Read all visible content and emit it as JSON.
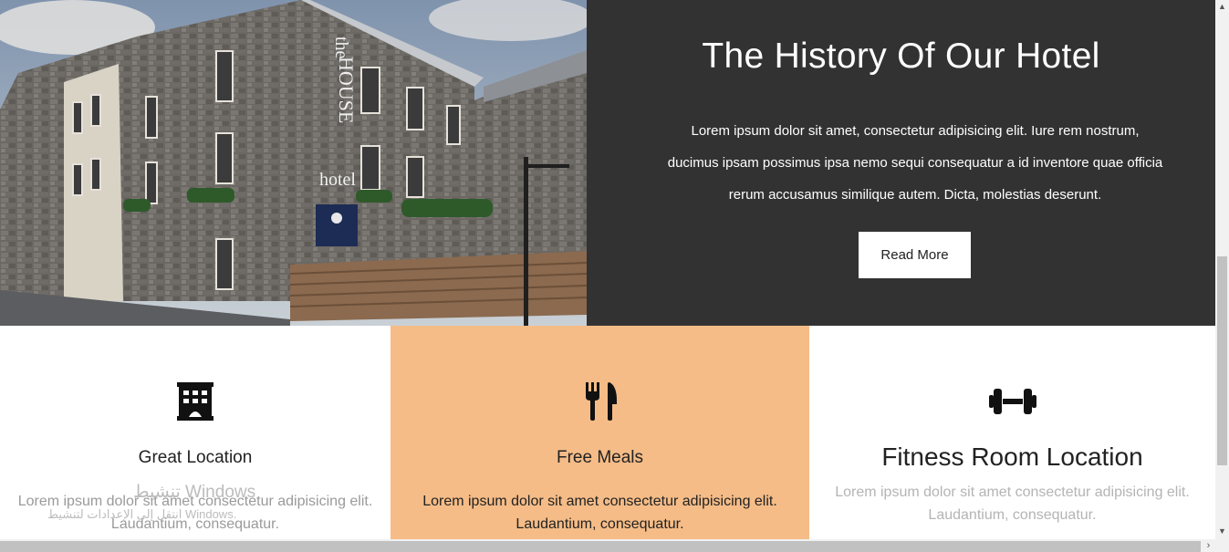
{
  "history": {
    "title": "The History Of Our Hotel",
    "description": "Lorem ipsum dolor sit amet, consectetur adipisicing elit. Iure rem nostrum, ducimus ipsam possimus ipsa nemo sequi consequatur a id inventore quae officia rerum accusamus similique autem. Dicta, molestias deserunt.",
    "button": "Read More",
    "photo_sign": "the HOUSE hotel"
  },
  "features": [
    {
      "icon": "building-icon",
      "title": "Great Location",
      "text": "Lorem ipsum dolor sit amet consectetur adipisicing elit. Laudantium, consequatur."
    },
    {
      "icon": "utensils-icon",
      "title": "Free Meals",
      "text": "Lorem ipsum dolor sit amet consectetur adipisicing elit. Laudantium, consequatur."
    },
    {
      "icon": "dumbbell-icon",
      "title": "Fitness Room Location",
      "text": "Lorem ipsum dolor sit amet consectetur adipisicing elit. Laudantium, consequatur."
    }
  ],
  "watermark": {
    "title": "تنشيط Windows",
    "subtitle": "انتقل إلى الإعدادات لتنشيط Windows."
  },
  "colors": {
    "history_bg": "#323232",
    "meals_bg": "#f5bc87"
  }
}
